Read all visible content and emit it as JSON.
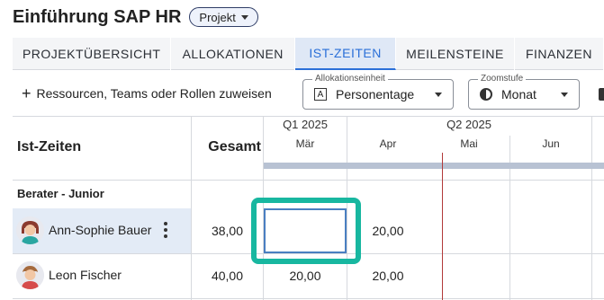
{
  "header": {
    "title": "Einführung SAP HR",
    "chip": "Projekt"
  },
  "tabs": [
    {
      "label": "PROJEKTÜBERSICHT",
      "active": false
    },
    {
      "label": "ALLOKATIONEN",
      "active": false
    },
    {
      "label": "IST-ZEITEN",
      "active": true
    },
    {
      "label": "MEILENSTEINE",
      "active": false
    },
    {
      "label": "FINANZEN",
      "active": false
    }
  ],
  "toolbar": {
    "assign_label": "Ressourcen, Teams oder Rollen zuweisen",
    "allocation_unit": {
      "label": "Allokationseinheit",
      "value": "Personentage"
    },
    "zoom": {
      "label": "Zoomstufe",
      "value": "Monat"
    }
  },
  "grid": {
    "title": "Ist-Zeiten",
    "total_header": "Gesamt",
    "quarters": [
      "Q1 2025",
      "Q2 2025"
    ],
    "months": [
      "Mär",
      "Apr",
      "Mai",
      "Jun"
    ],
    "group": "Berater - Junior",
    "rows": [
      {
        "name": "Ann-Sophie Bauer",
        "total": "38,00",
        "values": [
          "",
          "20,00",
          "",
          ""
        ],
        "selected": true
      },
      {
        "name": "Leon Fischer",
        "total": "40,00",
        "values": [
          "20,00",
          "20,00",
          "",
          ""
        ],
        "selected": false
      }
    ]
  },
  "colors": {
    "accent": "#2a6fd8",
    "highlight": "#18b7a0",
    "today_line": "#b23a3a",
    "selected_row": "#e3ebf6"
  }
}
